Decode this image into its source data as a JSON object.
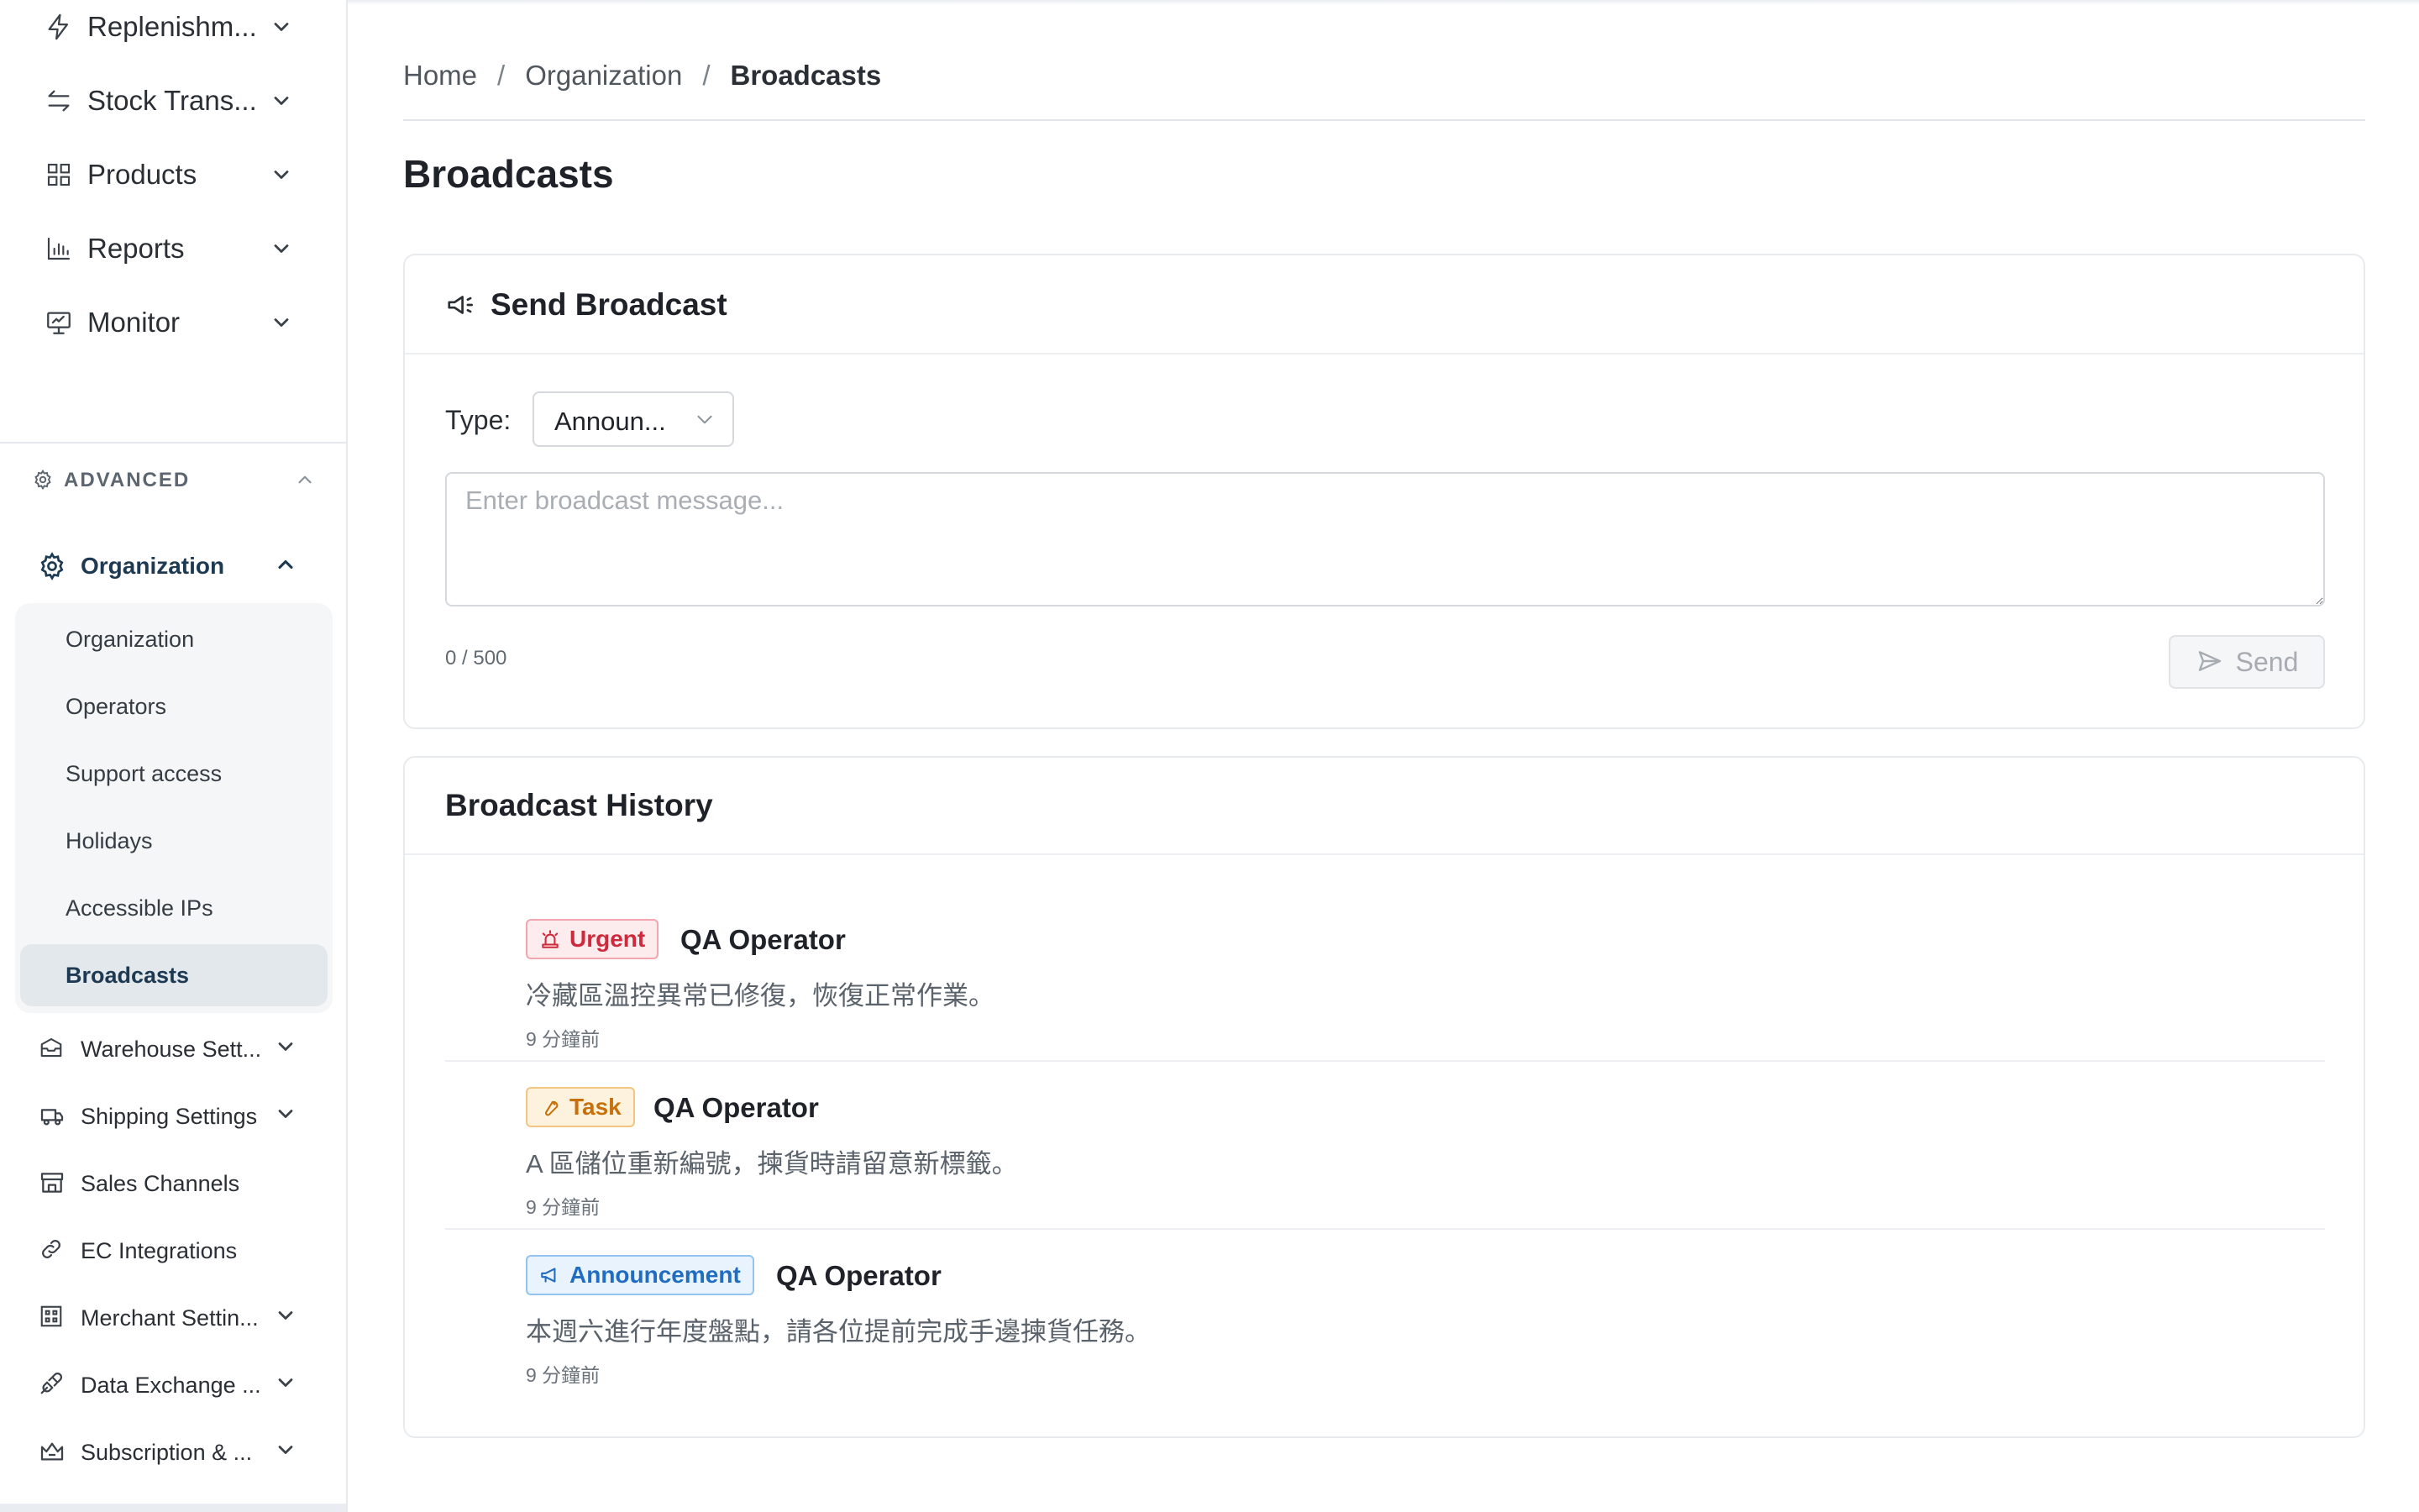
{
  "sidebar": {
    "top_items": [
      {
        "label": "Replenishm...",
        "icon": "lightning-icon"
      },
      {
        "label": "Stock Trans...",
        "icon": "transfer-arrows-icon"
      },
      {
        "label": "Products",
        "icon": "grid-icon"
      },
      {
        "label": "Reports",
        "icon": "bar-chart-icon"
      },
      {
        "label": "Monitor",
        "icon": "monitor-icon"
      }
    ],
    "advanced_label": "ADVANCED",
    "organization_label": "Organization",
    "org_sub_items": [
      {
        "label": "Organization"
      },
      {
        "label": "Operators"
      },
      {
        "label": "Support access"
      },
      {
        "label": "Holidays"
      },
      {
        "label": "Accessible IPs"
      },
      {
        "label": "Broadcasts",
        "active": true
      }
    ],
    "advanced_items": [
      {
        "label": "Warehouse Sett...",
        "icon": "warehouse-icon",
        "expandable": true
      },
      {
        "label": "Shipping Settings",
        "icon": "truck-icon",
        "expandable": true
      },
      {
        "label": "Sales Channels",
        "icon": "store-icon",
        "expandable": false
      },
      {
        "label": "EC Integrations",
        "icon": "link-icon",
        "expandable": false
      },
      {
        "label": "Merchant Settin...",
        "icon": "merchant-icon",
        "expandable": true
      },
      {
        "label": "Data Exchange ...",
        "icon": "plug-icon",
        "expandable": true
      },
      {
        "label": "Subscription & ...",
        "icon": "crown-icon",
        "expandable": true
      }
    ]
  },
  "breadcrumb": {
    "home": "Home",
    "separator": "/",
    "organization": "Organization",
    "current": "Broadcasts"
  },
  "page": {
    "title": "Broadcasts"
  },
  "send_card": {
    "title": "Send Broadcast",
    "type_label": "Type:",
    "type_value": "Announ...",
    "message_placeholder": "Enter broadcast message...",
    "message_value": "",
    "counter": "0 / 500",
    "send_label": "Send"
  },
  "history_card": {
    "title": "Broadcast History",
    "items": [
      {
        "type": "Urgent",
        "author": "QA Operator",
        "message": "冷藏區溫控異常已修復，恢復正常作業。",
        "time": "9 分鐘前"
      },
      {
        "type": "Task",
        "author": "QA Operator",
        "message": "A 區儲位重新編號，揀貨時請留意新標籤。",
        "time": "9 分鐘前"
      },
      {
        "type": "Announcement",
        "author": "QA Operator",
        "message": "本週六進行年度盤點，請各位提前完成手邊揀貨任務。",
        "time": "9 分鐘前"
      }
    ]
  },
  "colors": {
    "urgent": "#cf2a3b",
    "task": "#c7700a",
    "announcement": "#1f6cc0",
    "nav_active": "#1e3a52"
  }
}
